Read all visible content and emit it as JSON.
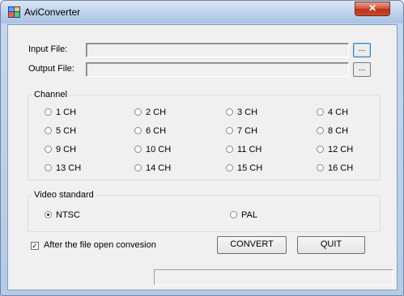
{
  "window": {
    "title": "AviConverter",
    "close_glyph": "✕",
    "icon": "aviconverter-app-icon"
  },
  "input_file": {
    "label": "Input File:",
    "value": "",
    "browse_label": "..."
  },
  "output_file": {
    "label": "Output File:",
    "value": "",
    "browse_label": "..."
  },
  "channel": {
    "title": "Channel",
    "options": [
      {
        "label": "1 CH",
        "selected": false
      },
      {
        "label": "2 CH",
        "selected": false
      },
      {
        "label": "3 CH",
        "selected": false
      },
      {
        "label": "4 CH",
        "selected": false
      },
      {
        "label": "5 CH",
        "selected": false
      },
      {
        "label": "6 CH",
        "selected": false
      },
      {
        "label": "7 CH",
        "selected": false
      },
      {
        "label": "8 CH",
        "selected": false
      },
      {
        "label": "9 CH",
        "selected": false
      },
      {
        "label": "10 CH",
        "selected": false
      },
      {
        "label": "11 CH",
        "selected": false
      },
      {
        "label": "12 CH",
        "selected": false
      },
      {
        "label": "13 CH",
        "selected": false
      },
      {
        "label": "14 CH",
        "selected": false
      },
      {
        "label": "15 CH",
        "selected": false
      },
      {
        "label": "16 CH",
        "selected": false
      }
    ]
  },
  "video_standard": {
    "title": "Video standard",
    "options": [
      {
        "label": "NTSC",
        "selected": true
      },
      {
        "label": "PAL",
        "selected": false
      }
    ]
  },
  "after_open": {
    "label": "After the file open convesion",
    "checked": true,
    "check_glyph": "✓"
  },
  "buttons": {
    "convert": "CONVERT",
    "quit": "QUIT"
  },
  "status_bar": {
    "text": ""
  },
  "colors": {
    "frame": "#b3cbe6",
    "client": "#f0f0f0",
    "close": "#c94a30"
  }
}
